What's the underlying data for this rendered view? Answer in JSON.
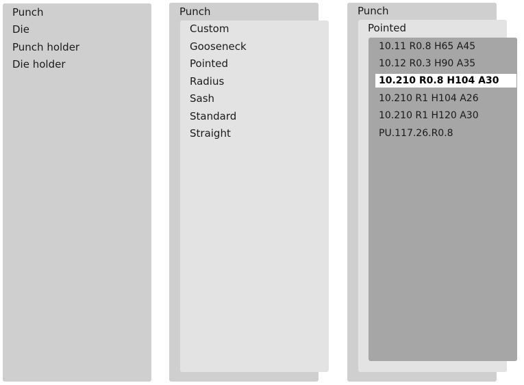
{
  "column1": {
    "items": [
      {
        "label": "Punch"
      },
      {
        "label": "Die"
      },
      {
        "label": "Punch holder"
      },
      {
        "label": "Die holder"
      }
    ]
  },
  "column2": {
    "header": "Punch",
    "items": [
      {
        "label": "Custom"
      },
      {
        "label": "Gooseneck"
      },
      {
        "label": "Pointed"
      },
      {
        "label": "Radius"
      },
      {
        "label": "Sash"
      },
      {
        "label": "Standard"
      },
      {
        "label": "Straight"
      }
    ]
  },
  "column3": {
    "header": "Punch",
    "subheader": "Pointed",
    "items": [
      {
        "label": "10.11 R0.8 H65 A45"
      },
      {
        "label": "10.12 R0.3 H90 A35"
      },
      {
        "label": "10.210 R0.8 H104 A30",
        "selected": true
      },
      {
        "label": "10.210 R1 H104 A26"
      },
      {
        "label": "10.210 R1 H120 A30"
      },
      {
        "label": "PU.117.26.R0.8"
      }
    ]
  }
}
